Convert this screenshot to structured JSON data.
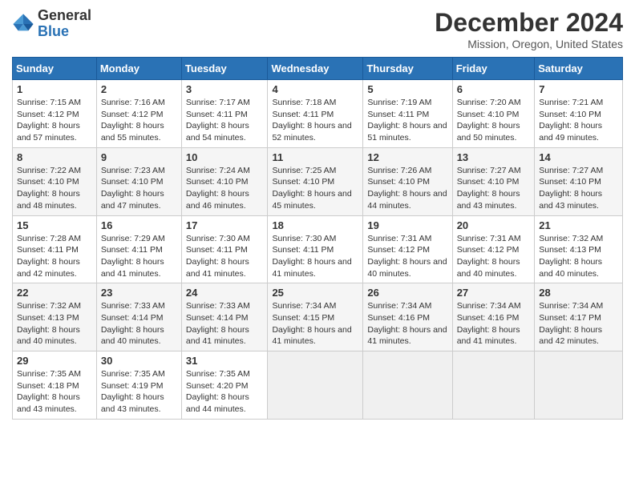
{
  "header": {
    "logo_general": "General",
    "logo_blue": "Blue",
    "month_title": "December 2024",
    "location": "Mission, Oregon, United States"
  },
  "weekdays": [
    "Sunday",
    "Monday",
    "Tuesday",
    "Wednesday",
    "Thursday",
    "Friday",
    "Saturday"
  ],
  "weeks": [
    [
      {
        "day": "1",
        "sunrise": "7:15 AM",
        "sunset": "4:12 PM",
        "daylight": "8 hours and 57 minutes."
      },
      {
        "day": "2",
        "sunrise": "7:16 AM",
        "sunset": "4:12 PM",
        "daylight": "8 hours and 55 minutes."
      },
      {
        "day": "3",
        "sunrise": "7:17 AM",
        "sunset": "4:11 PM",
        "daylight": "8 hours and 54 minutes."
      },
      {
        "day": "4",
        "sunrise": "7:18 AM",
        "sunset": "4:11 PM",
        "daylight": "8 hours and 52 minutes."
      },
      {
        "day": "5",
        "sunrise": "7:19 AM",
        "sunset": "4:11 PM",
        "daylight": "8 hours and 51 minutes."
      },
      {
        "day": "6",
        "sunrise": "7:20 AM",
        "sunset": "4:10 PM",
        "daylight": "8 hours and 50 minutes."
      },
      {
        "day": "7",
        "sunrise": "7:21 AM",
        "sunset": "4:10 PM",
        "daylight": "8 hours and 49 minutes."
      }
    ],
    [
      {
        "day": "8",
        "sunrise": "7:22 AM",
        "sunset": "4:10 PM",
        "daylight": "8 hours and 48 minutes."
      },
      {
        "day": "9",
        "sunrise": "7:23 AM",
        "sunset": "4:10 PM",
        "daylight": "8 hours and 47 minutes."
      },
      {
        "day": "10",
        "sunrise": "7:24 AM",
        "sunset": "4:10 PM",
        "daylight": "8 hours and 46 minutes."
      },
      {
        "day": "11",
        "sunrise": "7:25 AM",
        "sunset": "4:10 PM",
        "daylight": "8 hours and 45 minutes."
      },
      {
        "day": "12",
        "sunrise": "7:26 AM",
        "sunset": "4:10 PM",
        "daylight": "8 hours and 44 minutes."
      },
      {
        "day": "13",
        "sunrise": "7:27 AM",
        "sunset": "4:10 PM",
        "daylight": "8 hours and 43 minutes."
      },
      {
        "day": "14",
        "sunrise": "7:27 AM",
        "sunset": "4:10 PM",
        "daylight": "8 hours and 43 minutes."
      }
    ],
    [
      {
        "day": "15",
        "sunrise": "7:28 AM",
        "sunset": "4:11 PM",
        "daylight": "8 hours and 42 minutes."
      },
      {
        "day": "16",
        "sunrise": "7:29 AM",
        "sunset": "4:11 PM",
        "daylight": "8 hours and 41 minutes."
      },
      {
        "day": "17",
        "sunrise": "7:30 AM",
        "sunset": "4:11 PM",
        "daylight": "8 hours and 41 minutes."
      },
      {
        "day": "18",
        "sunrise": "7:30 AM",
        "sunset": "4:11 PM",
        "daylight": "8 hours and 41 minutes."
      },
      {
        "day": "19",
        "sunrise": "7:31 AM",
        "sunset": "4:12 PM",
        "daylight": "8 hours and 40 minutes."
      },
      {
        "day": "20",
        "sunrise": "7:31 AM",
        "sunset": "4:12 PM",
        "daylight": "8 hours and 40 minutes."
      },
      {
        "day": "21",
        "sunrise": "7:32 AM",
        "sunset": "4:13 PM",
        "daylight": "8 hours and 40 minutes."
      }
    ],
    [
      {
        "day": "22",
        "sunrise": "7:32 AM",
        "sunset": "4:13 PM",
        "daylight": "8 hours and 40 minutes."
      },
      {
        "day": "23",
        "sunrise": "7:33 AM",
        "sunset": "4:14 PM",
        "daylight": "8 hours and 40 minutes."
      },
      {
        "day": "24",
        "sunrise": "7:33 AM",
        "sunset": "4:14 PM",
        "daylight": "8 hours and 41 minutes."
      },
      {
        "day": "25",
        "sunrise": "7:34 AM",
        "sunset": "4:15 PM",
        "daylight": "8 hours and 41 minutes."
      },
      {
        "day": "26",
        "sunrise": "7:34 AM",
        "sunset": "4:16 PM",
        "daylight": "8 hours and 41 minutes."
      },
      {
        "day": "27",
        "sunrise": "7:34 AM",
        "sunset": "4:16 PM",
        "daylight": "8 hours and 41 minutes."
      },
      {
        "day": "28",
        "sunrise": "7:34 AM",
        "sunset": "4:17 PM",
        "daylight": "8 hours and 42 minutes."
      }
    ],
    [
      {
        "day": "29",
        "sunrise": "7:35 AM",
        "sunset": "4:18 PM",
        "daylight": "8 hours and 43 minutes."
      },
      {
        "day": "30",
        "sunrise": "7:35 AM",
        "sunset": "4:19 PM",
        "daylight": "8 hours and 43 minutes."
      },
      {
        "day": "31",
        "sunrise": "7:35 AM",
        "sunset": "4:20 PM",
        "daylight": "8 hours and 44 minutes."
      },
      null,
      null,
      null,
      null
    ]
  ]
}
